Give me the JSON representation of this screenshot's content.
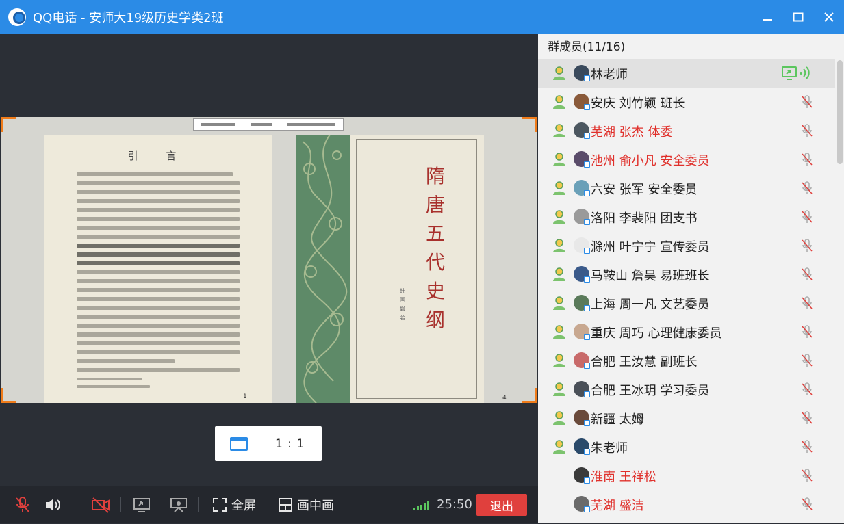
{
  "window": {
    "title": "QQ电话 - 安师大19级历史学类2班",
    "minimize_icon": "minimize-icon",
    "maximize_icon": "maximize-icon",
    "close_icon": "close-icon"
  },
  "share": {
    "page_heading": "引 言",
    "left_page_number": "1",
    "right_page_number": "4",
    "cover_title": "隋唐五代史纲",
    "cover_author": "韩国磐著"
  },
  "ratio_button": {
    "label": "1 : 1"
  },
  "toolbar": {
    "fullscreen_label": "全屏",
    "pip_label": "画中画",
    "timer": "25:50",
    "exit_label": "退出"
  },
  "panel": {
    "header": "群成员(11/16)",
    "members": [
      {
        "name": "林老师",
        "red": false,
        "role": true,
        "state": "sharing",
        "avatar": "#3a4a5c"
      },
      {
        "name": "安庆 刘竹颖 班长",
        "red": false,
        "role": true,
        "state": "muted",
        "avatar": "#8a5a3a"
      },
      {
        "name": "芜湖 张杰 体委",
        "red": true,
        "role": true,
        "state": "muted",
        "avatar": "#4c5760"
      },
      {
        "name": "池州 俞小凡 安全委员",
        "red": true,
        "role": true,
        "state": "muted",
        "avatar": "#5a4c6a"
      },
      {
        "name": "六安 张军 安全委员",
        "red": false,
        "role": true,
        "state": "muted",
        "avatar": "#6aa0b8"
      },
      {
        "name": "洛阳 李裴阳 团支书",
        "red": false,
        "role": true,
        "state": "muted",
        "avatar": "#9a9a9a"
      },
      {
        "name": "滁州 叶宁宁 宣传委员",
        "red": false,
        "role": true,
        "state": "muted",
        "avatar": "#e8e8e8"
      },
      {
        "name": "马鞍山 詹昊 易班班长",
        "red": false,
        "role": true,
        "state": "muted",
        "avatar": "#3a5a8a"
      },
      {
        "name": "上海 周一凡 文艺委员",
        "red": false,
        "role": true,
        "state": "muted",
        "avatar": "#5a7a5a"
      },
      {
        "name": "重庆 周巧 心理健康委员",
        "red": false,
        "role": true,
        "state": "muted",
        "avatar": "#c8a890"
      },
      {
        "name": "合肥 王汝慧 副班长",
        "red": false,
        "role": true,
        "state": "muted",
        "avatar": "#c86a6a"
      },
      {
        "name": "合肥 王冰玥 学习委员",
        "red": false,
        "role": true,
        "state": "muted",
        "avatar": "#4a5058"
      },
      {
        "name": "新疆  太姆",
        "red": false,
        "role": true,
        "state": "muted",
        "avatar": "#6a4a3a"
      },
      {
        "name": "朱老师",
        "red": false,
        "role": true,
        "state": "muted",
        "avatar": "#2a4a6a"
      },
      {
        "name": "淮南 王祥松",
        "red": true,
        "role": false,
        "state": "muted",
        "avatar": "#3a3a3a"
      },
      {
        "name": "芜湖  盛洁",
        "red": true,
        "role": false,
        "state": "muted",
        "avatar": "#6a6a6a"
      }
    ]
  },
  "colors": {
    "title_bar": "#2b8be6",
    "exit": "#e0403d",
    "accent_orange": "#f07c1a",
    "name_red": "#e0302b",
    "share_green": "#5bc65e"
  }
}
